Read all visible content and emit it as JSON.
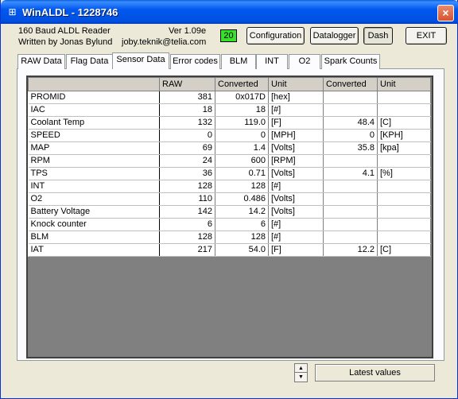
{
  "window": {
    "title": "WinALDL - 1228746",
    "icon": "app-icon",
    "close_label": "×"
  },
  "header": {
    "line1": "160 Baud ALDL Reader",
    "line2": "Written by Jonas Bylund",
    "version": "Ver 1.09e",
    "email": "joby.teknik@telia.com",
    "led_value": "20",
    "led_color": "#39e22a"
  },
  "buttons": {
    "configuration": "Configuration",
    "datalogger": "Datalogger",
    "dash": "Dash",
    "exit": "EXIT"
  },
  "tabs": [
    {
      "label": "RAW Data"
    },
    {
      "label": "Flag Data"
    },
    {
      "label": "Sensor Data"
    },
    {
      "label": "Error codes"
    },
    {
      "label": "BLM"
    },
    {
      "label": "INT"
    },
    {
      "label": "O2"
    },
    {
      "label": "Spark Counts"
    }
  ],
  "active_tab": "Sensor Data",
  "table": {
    "headers": [
      "",
      "RAW",
      "Converted",
      "Unit",
      "Converted",
      "Unit"
    ],
    "rows": [
      [
        "PROMID",
        "381",
        "0x017D",
        "[hex]",
        "",
        ""
      ],
      [
        "IAC",
        "18",
        "18",
        "[#]",
        "",
        ""
      ],
      [
        "Coolant Temp",
        "132",
        "119.0",
        "[F]",
        "48.4",
        "[C]"
      ],
      [
        "SPEED",
        "0",
        "0",
        "[MPH]",
        "0",
        "[KPH]"
      ],
      [
        "MAP",
        "69",
        "1.4",
        "[Volts]",
        "35.8",
        "[kpa]"
      ],
      [
        "RPM",
        "24",
        "600",
        "[RPM]",
        "",
        ""
      ],
      [
        "TPS",
        "36",
        "0.71",
        "[Volts]",
        "4.1",
        "[%]"
      ],
      [
        "INT",
        "128",
        "128",
        "[#]",
        "",
        ""
      ],
      [
        "O2",
        "110",
        "0.486",
        "[Volts]",
        "",
        ""
      ],
      [
        "Battery Voltage",
        "142",
        "14.2",
        "[Volts]",
        "",
        ""
      ],
      [
        "Knock counter",
        "6",
        "6",
        "[#]",
        "",
        ""
      ],
      [
        "BLM",
        "128",
        "128",
        "[#]",
        "",
        ""
      ],
      [
        "IAT",
        "217",
        "54.0",
        "[F]",
        "12.2",
        "[C]"
      ]
    ]
  },
  "footer": {
    "spin_up": "▲",
    "spin_down": "▼",
    "status": "Latest values"
  }
}
